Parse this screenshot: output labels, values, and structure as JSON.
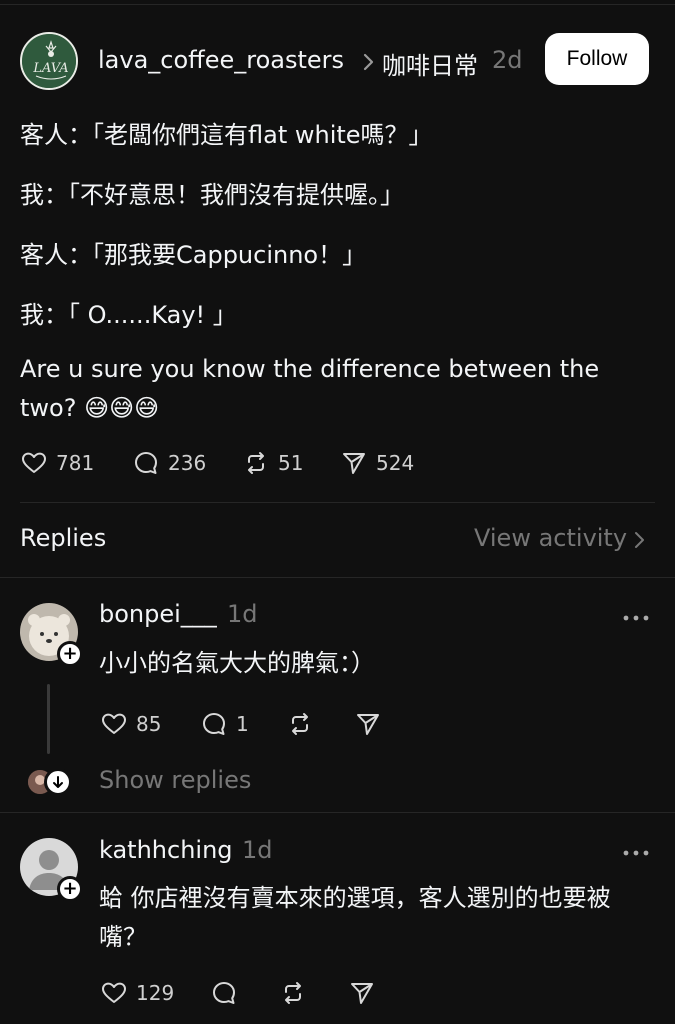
{
  "post": {
    "author": "lava_coffee_roasters",
    "topic": "咖啡日常",
    "time": "2d",
    "follow_label": "Follow",
    "lines": [
      "客人：「老闆你們這有flat white嗎？」",
      "我：「不好意思！我們沒有提供喔。」",
      "客人：「那我要Cappucinno！」",
      "我：「 O......Kay! 」",
      "Are u sure you know the difference between the",
      "two? 😅😅😅"
    ],
    "likes": "781",
    "comments": "236",
    "reposts": "51",
    "shares": "524"
  },
  "replies_header": {
    "title": "Replies",
    "view_activity": "View activity"
  },
  "replies": [
    {
      "name": "bonpei___",
      "time": "1d",
      "text": "小小的名氣大大的脾氣：）",
      "likes": "85",
      "comments": "1",
      "show_replies": "Show replies"
    },
    {
      "name": "kathhching",
      "time": "1d",
      "text_line1": "蛤 你店裡沒有賣本來的選項，客人選別的也要被",
      "text_line2": "嘴？",
      "likes": "129"
    }
  ],
  "colors": {
    "background": "#101010",
    "text": "#f3f5f7",
    "muted": "#777777",
    "divider": "#262626",
    "follow_bg": "#ffffff"
  }
}
